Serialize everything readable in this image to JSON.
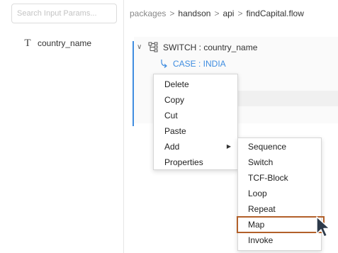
{
  "left_panel": {
    "search": {
      "placeholder": "Search Input Params...",
      "value": ""
    },
    "params": [
      {
        "type_icon": "text-type-icon",
        "type_glyph": "T",
        "name": "country_name"
      }
    ]
  },
  "breadcrumb": {
    "items": [
      "packages",
      "handson",
      "api",
      "findCapital.flow"
    ],
    "separator": ">"
  },
  "flow": {
    "switch_label": "SWITCH : country_name",
    "case_label": "CASE : INDIA"
  },
  "context_menu": {
    "items": [
      "Delete",
      "Copy",
      "Cut",
      "Paste",
      "Add",
      "Properties"
    ],
    "submenu_arrow": "▶"
  },
  "submenu": {
    "items": [
      "Sequence",
      "Switch",
      "TCF-Block",
      "Loop",
      "Repeat",
      "Map",
      "Invoke"
    ],
    "highlighted": "Map"
  },
  "colors": {
    "accent": "#3f8de0",
    "highlight_border": "#b2602a",
    "cursor": "#2d3a4a"
  }
}
